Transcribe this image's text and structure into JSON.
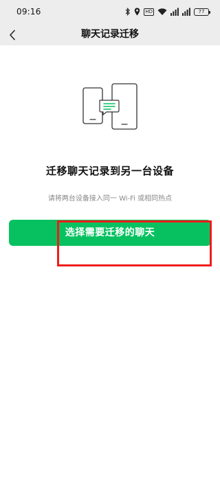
{
  "status_bar": {
    "time": "09:16",
    "hd_label": "HD",
    "battery_level": "77"
  },
  "nav": {
    "title": "聊天记录迁移"
  },
  "main": {
    "title": "迁移聊天记录到另一台设备",
    "subtitle": "请将两台设备接入同一 Wi-Fi 或相同热点",
    "button_label": "选择需要迁移的聊天"
  },
  "colors": {
    "accent": "#07c160",
    "highlight": "#f01c1c",
    "header_bg": "#ededed"
  },
  "icons": [
    "bluetooth-icon",
    "location-icon",
    "hd-icon",
    "wifi-icon",
    "signal-icon",
    "battery-icon",
    "back-arrow-icon",
    "devices-transfer-illustration"
  ]
}
